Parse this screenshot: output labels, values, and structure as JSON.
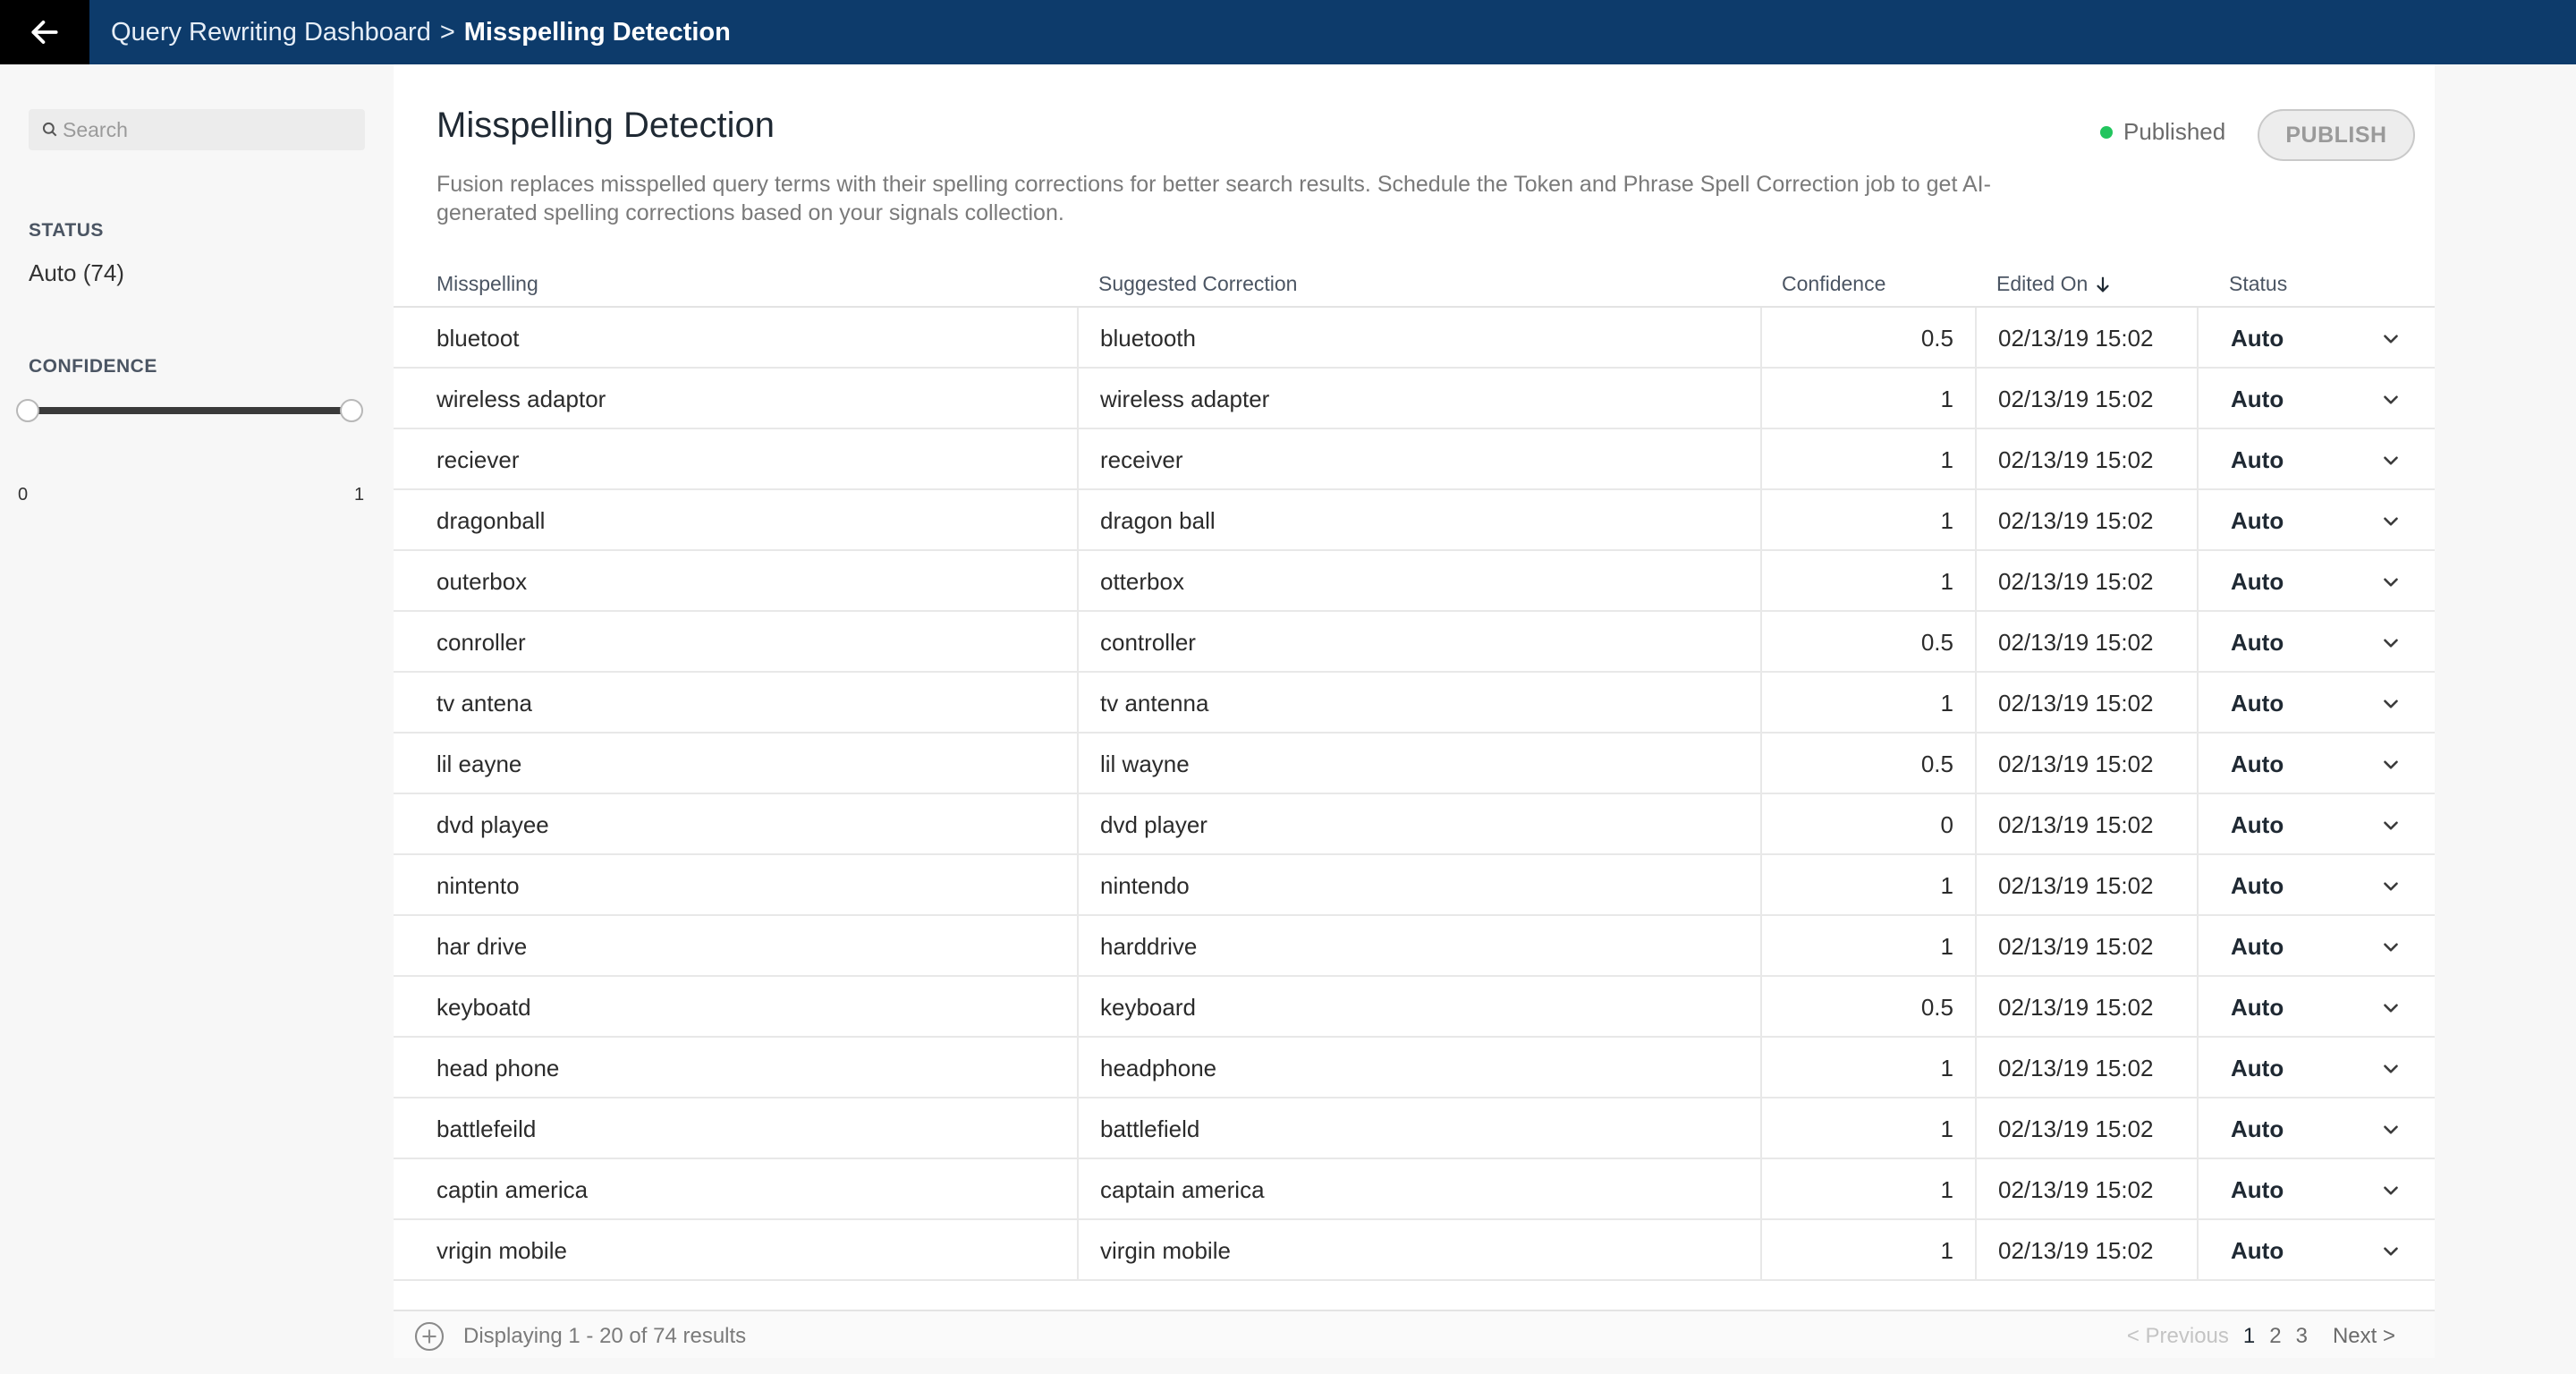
{
  "header": {
    "breadcrumb_parent": "Query Rewriting Dashboard",
    "separator": ">",
    "breadcrumb_current": "Misspelling Detection",
    "back_icon": "arrow-left-icon"
  },
  "sidebar": {
    "search_placeholder": "Search",
    "status_heading": "STATUS",
    "status_value": "Auto (74)",
    "confidence_heading": "CONFIDENCE",
    "confidence_min": "0",
    "confidence_max": "1"
  },
  "main": {
    "title": "Misspelling Detection",
    "description": "Fusion replaces misspelled query terms with their spelling corrections for better search results. Schedule the Token and Phrase Spell Correction job to get AI-generated spelling corrections based on your signals collection.",
    "publish_status": "Published",
    "publish_status_color": "#22c55e",
    "publish_button": "PUBLISH"
  },
  "table": {
    "columns": {
      "misspelling": "Misspelling",
      "suggested": "Suggested Correction",
      "confidence": "Confidence",
      "edited_on": "Edited On",
      "status": "Status"
    },
    "rows": [
      {
        "misspelling": "bluetoot",
        "suggested": "bluetooth",
        "confidence": "0.5",
        "edited_on": "02/13/19 15:02",
        "status": "Auto"
      },
      {
        "misspelling": "wireless adaptor",
        "suggested": "wireless adapter",
        "confidence": "1",
        "edited_on": "02/13/19 15:02",
        "status": "Auto"
      },
      {
        "misspelling": "reciever",
        "suggested": "receiver",
        "confidence": "1",
        "edited_on": "02/13/19 15:02",
        "status": "Auto"
      },
      {
        "misspelling": "dragonball",
        "suggested": "dragon ball",
        "confidence": "1",
        "edited_on": "02/13/19 15:02",
        "status": "Auto"
      },
      {
        "misspelling": "outerbox",
        "suggested": "otterbox",
        "confidence": "1",
        "edited_on": "02/13/19 15:02",
        "status": "Auto"
      },
      {
        "misspelling": "conroller",
        "suggested": "controller",
        "confidence": "0.5",
        "edited_on": "02/13/19 15:02",
        "status": "Auto"
      },
      {
        "misspelling": "tv antena",
        "suggested": "tv antenna",
        "confidence": "1",
        "edited_on": "02/13/19 15:02",
        "status": "Auto"
      },
      {
        "misspelling": "lil eayne",
        "suggested": "lil wayne",
        "confidence": "0.5",
        "edited_on": "02/13/19 15:02",
        "status": "Auto"
      },
      {
        "misspelling": "dvd playee",
        "suggested": "dvd player",
        "confidence": "0",
        "edited_on": "02/13/19 15:02",
        "status": "Auto"
      },
      {
        "misspelling": "nintento",
        "suggested": "nintendo",
        "confidence": "1",
        "edited_on": "02/13/19 15:02",
        "status": "Auto"
      },
      {
        "misspelling": "har drive",
        "suggested": "harddrive",
        "confidence": "1",
        "edited_on": "02/13/19 15:02",
        "status": "Auto"
      },
      {
        "misspelling": "keyboatd",
        "suggested": "keyboard",
        "confidence": "0.5",
        "edited_on": "02/13/19 15:02",
        "status": "Auto"
      },
      {
        "misspelling": "head phone",
        "suggested": "headphone",
        "confidence": "1",
        "edited_on": "02/13/19 15:02",
        "status": "Auto"
      },
      {
        "misspelling": "battlefeild",
        "suggested": "battlefield",
        "confidence": "1",
        "edited_on": "02/13/19 15:02",
        "status": "Auto"
      },
      {
        "misspelling": "captin america",
        "suggested": "captain america",
        "confidence": "1",
        "edited_on": "02/13/19 15:02",
        "status": "Auto"
      },
      {
        "misspelling": "vrigin mobile",
        "suggested": "virgin mobile",
        "confidence": "1",
        "edited_on": "02/13/19 15:02",
        "status": "Auto"
      }
    ]
  },
  "footer": {
    "displaying": "Displaying 1 - 20 of 74 results",
    "prev": "< Previous",
    "pages": [
      "1",
      "2",
      "3"
    ],
    "next": "Next >"
  }
}
